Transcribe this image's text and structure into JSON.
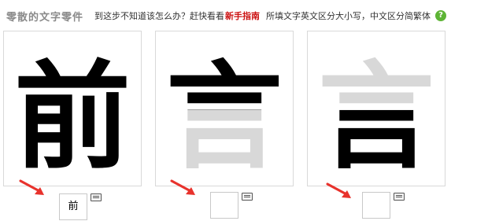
{
  "header": {
    "title": "零散的文字零件",
    "hint": "到这步不知道该怎么办？赶快看看",
    "guide_link": "新手指南",
    "note": "所填文字英文区分大小写，中文区分简繁体",
    "help_icon": "?"
  },
  "cards": [
    {
      "glyph": "前",
      "input_value": "前",
      "style": "full-black"
    },
    {
      "glyph": "言",
      "input_value": "",
      "style": "top-black"
    },
    {
      "glyph": "言",
      "input_value": "",
      "style": "bottom-black"
    }
  ],
  "colors": {
    "arrow": "#e8322c",
    "ghost": "#d8d8d8",
    "ink": "#000000",
    "help": "#5db435",
    "link": "#cc1111"
  },
  "icons": [
    "help-icon",
    "keyboard-icon",
    "red-arrow-icon"
  ]
}
